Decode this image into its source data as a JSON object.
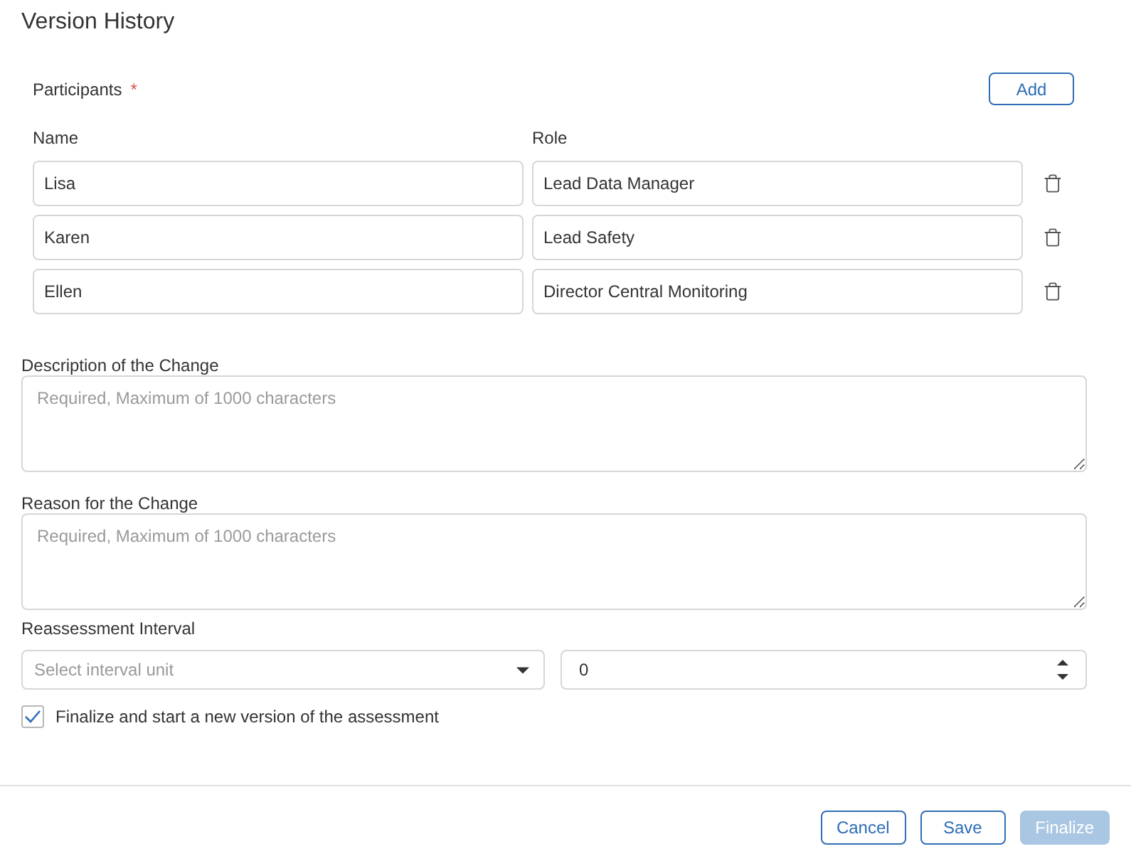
{
  "title": "Version History",
  "participants": {
    "label": "Participants",
    "required_mark": "*",
    "add_button": "Add",
    "columns": [
      "Name",
      "Role"
    ],
    "rows": [
      {
        "name": "Lisa",
        "role": "Lead Data Manager"
      },
      {
        "name": "Karen",
        "role": "Lead Safety"
      },
      {
        "name": "Ellen",
        "role": "Director Central Monitoring"
      }
    ]
  },
  "text_fields": [
    {
      "label": "Description of the Change",
      "placeholder": "Required, Maximum of 1000 characters"
    },
    {
      "label": "Reason for the Change",
      "placeholder": "Required, Maximum of 1000 characters"
    }
  ],
  "reassessment": {
    "label": "Reassessment Interval",
    "unit_select": {
      "placeholder": "Select interval unit"
    },
    "number": {
      "value": "0"
    }
  },
  "finalize_checkbox": {
    "label": "Finalize and start a new version of the assessment",
    "checked": true
  },
  "buttons": [
    {
      "label": "Cancel",
      "kind": "outline",
      "disabled": false
    },
    {
      "label": "Save",
      "kind": "outline",
      "disabled": false
    },
    {
      "label": "Finalize",
      "kind": "primary",
      "disabled": true
    }
  ]
}
